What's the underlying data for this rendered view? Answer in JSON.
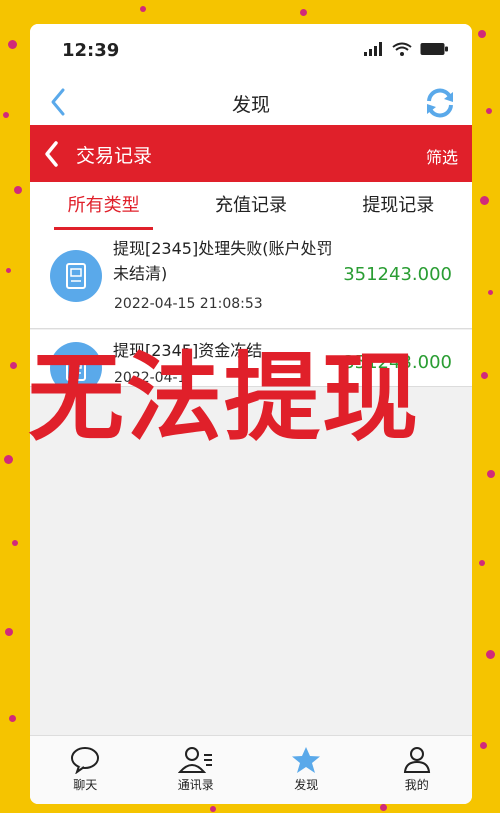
{
  "status_bar": {
    "time": "12:39"
  },
  "nav": {
    "title": "发现"
  },
  "header": {
    "title": "交易记录",
    "filter_label": "筛选"
  },
  "tabs": [
    {
      "label": "所有类型",
      "active": true
    },
    {
      "label": "充值记录",
      "active": false
    },
    {
      "label": "提现记录",
      "active": false
    }
  ],
  "records": [
    {
      "title": "提现[2345]处理失败(账户处罚未结清)",
      "date": "2022-04-15 21:08:53",
      "amount": "351243.000",
      "icon": "receipt-icon"
    },
    {
      "title": "提现[2345]资金冻结",
      "date": "2022-04-1",
      "amount": "351243.000",
      "icon": "receipt-icon"
    }
  ],
  "overlay_text": "无法提现",
  "bottom_nav": [
    {
      "label": "聊天",
      "icon": "chat-icon"
    },
    {
      "label": "通讯录",
      "icon": "contacts-icon"
    },
    {
      "label": "发现",
      "icon": "star-icon"
    },
    {
      "label": "我的",
      "icon": "person-icon"
    }
  ],
  "colors": {
    "accent": "#e0202a",
    "amount": "#2a9d33",
    "background": "#f5c400",
    "icon_blue": "#5aa9ea"
  }
}
